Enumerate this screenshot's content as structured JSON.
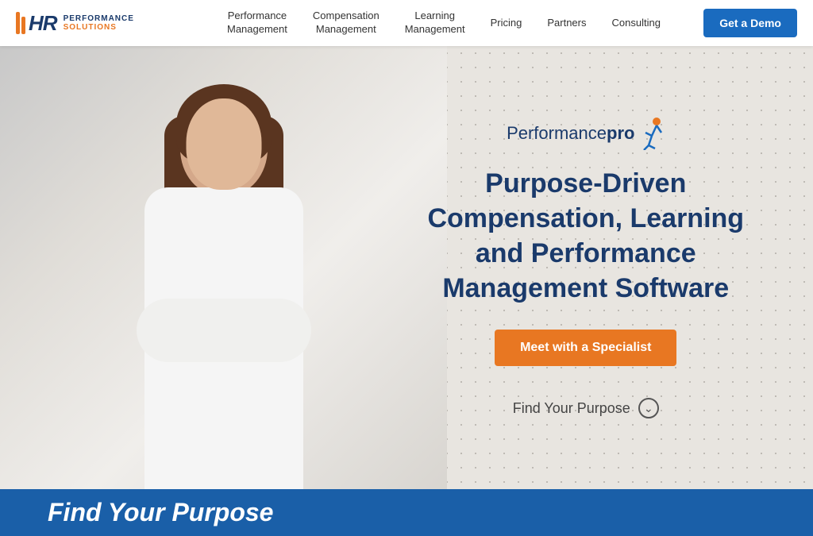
{
  "navbar": {
    "logo": {
      "hr": "HR",
      "performance": "PERFORMANCE",
      "solutions": "SOLUTIONS"
    },
    "nav_items": [
      {
        "id": "performance-management",
        "line1": "Performance",
        "line2": "Management"
      },
      {
        "id": "compensation-management",
        "line1": "Compensation",
        "line2": "Management"
      },
      {
        "id": "learning-management",
        "line1": "Learning",
        "line2": "Management"
      },
      {
        "id": "pricing",
        "line1": "Pricing",
        "line2": null
      },
      {
        "id": "partners",
        "line1": "Partners",
        "line2": null
      },
      {
        "id": "consulting",
        "line1": "Consulting",
        "line2": null
      }
    ],
    "cta_button": "Get a Demo"
  },
  "hero": {
    "brand_name_normal": "Performance",
    "brand_name_bold": "pro",
    "headline_line1": "Purpose-Driven",
    "headline_line2": "Compensation, Learning",
    "headline_line3": "and Performance",
    "headline_line4": "Management Software",
    "cta_button": "Meet with a Specialist",
    "find_purpose": "Find Your Purpose"
  },
  "footer": {
    "title": "Find Your Purpose"
  },
  "colors": {
    "primary_blue": "#1a3a6b",
    "accent_orange": "#e87722",
    "nav_blue": "#1a6bbf",
    "footer_blue": "#1a5fa8"
  }
}
